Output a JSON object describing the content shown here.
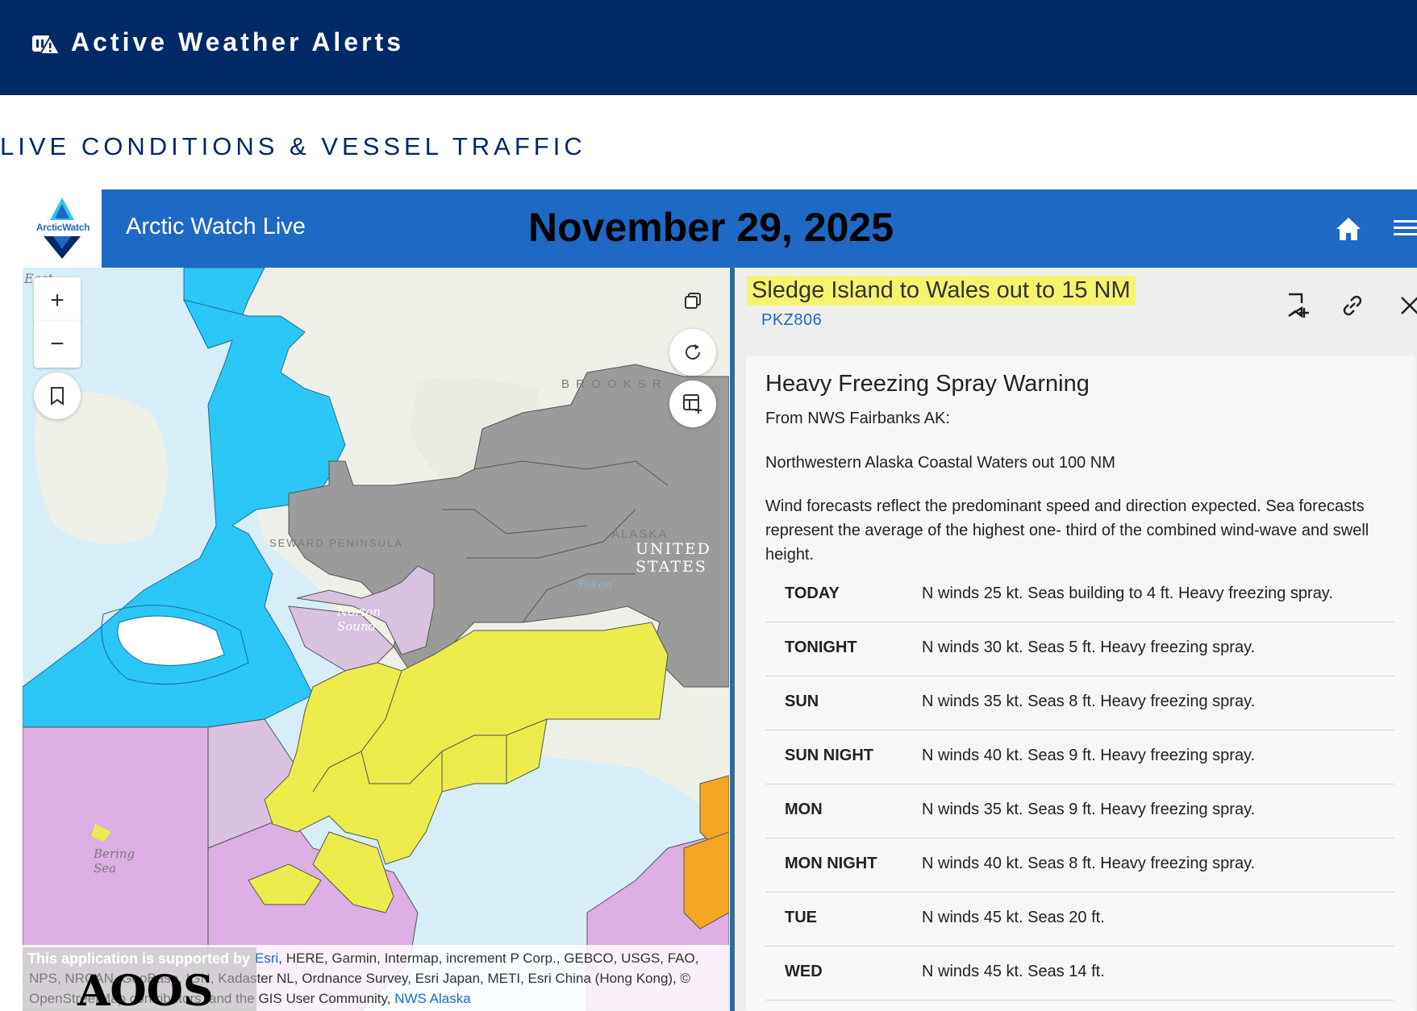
{
  "banner": {
    "title": "Active Weather Alerts",
    "icon": "weather-alert-icon",
    "background": "#012966"
  },
  "section_heading": "LIVE CONDITIONS & VESSEL TRAFFIC",
  "app": {
    "logo_text": "ArcticWatch",
    "title": "Arctic Watch Live",
    "date_overlay": "November 29, 2025",
    "bar_color": "#1e69c4",
    "icons": {
      "home": "home-icon",
      "menu": "menu-icon"
    }
  },
  "map": {
    "controls": {
      "zoom_in": "+",
      "zoom_out": "−",
      "icons": [
        "bookmark-icon",
        "copy-icon",
        "refresh-icon",
        "add-table-icon"
      ]
    },
    "labels": {
      "east": "East",
      "seward": "SEWARD PENINSULA",
      "norton": "Norton\nSound",
      "brooks": "B R O O K S   R",
      "alaska": "ALASKA",
      "united_states": "UNITED\nSTATES",
      "yukon": "Yukon",
      "bering": "Bering\nSea"
    },
    "zone_colors": {
      "freezing_spray": "#2ac7f7",
      "gale": "#dcaee4",
      "winter_weather": "#ecec4c",
      "special_weather": "#9b9b9b",
      "storm": "#f5a623",
      "light_purple": "#d8c2e0"
    },
    "attribution": {
      "prefix": "Esri",
      "text": ", HERE, Garmin, Intermap, increment P Corp., GEBCO, USGS, FAO, NPS, NRCAN, GeoBase, IGN, Kadaster NL, Ordnance Survey, Esri Japan, METI, Esri China (Hong Kong), © OpenStreetMap contributors, and the GIS User Community,",
      "link": "NWS Alaska"
    },
    "support": {
      "text": "This application is supported by",
      "logo": "AOOS"
    }
  },
  "panel": {
    "zone_title": "Sledge Island to Wales out to 15 NM",
    "zone_code": "PKZ806",
    "icons": [
      "add-bookmark-icon",
      "link-icon",
      "close-icon"
    ],
    "alert": {
      "title": "Heavy Freezing Spray Warning",
      "source": "From NWS Fairbanks AK:",
      "area": "Northwestern Alaska Coastal Waters out 100 NM",
      "note": "Wind forecasts reflect the predominant speed and direction expected. Sea forecasts represent the average of the highest one- third of the combined wind-wave and swell height."
    },
    "forecast": [
      {
        "day": "TODAY",
        "text": "N winds 25 kt. Seas building to 4 ft. Heavy freezing spray."
      },
      {
        "day": "TONIGHT",
        "text": "N winds 30 kt. Seas 5 ft. Heavy freezing spray."
      },
      {
        "day": "SUN",
        "text": "N winds 35 kt. Seas 8 ft. Heavy freezing spray."
      },
      {
        "day": "SUN NIGHT",
        "text": "N winds 40 kt. Seas 9 ft. Heavy freezing spray."
      },
      {
        "day": "MON",
        "text": "N winds 35 kt. Seas 9 ft. Heavy freezing spray."
      },
      {
        "day": "MON NIGHT",
        "text": "N winds 40 kt. Seas 8 ft. Heavy freezing spray."
      },
      {
        "day": "TUE",
        "text": "N winds 45 kt. Seas 20 ft."
      },
      {
        "day": "WED",
        "text": "N winds 45 kt. Seas 14 ft."
      }
    ]
  }
}
